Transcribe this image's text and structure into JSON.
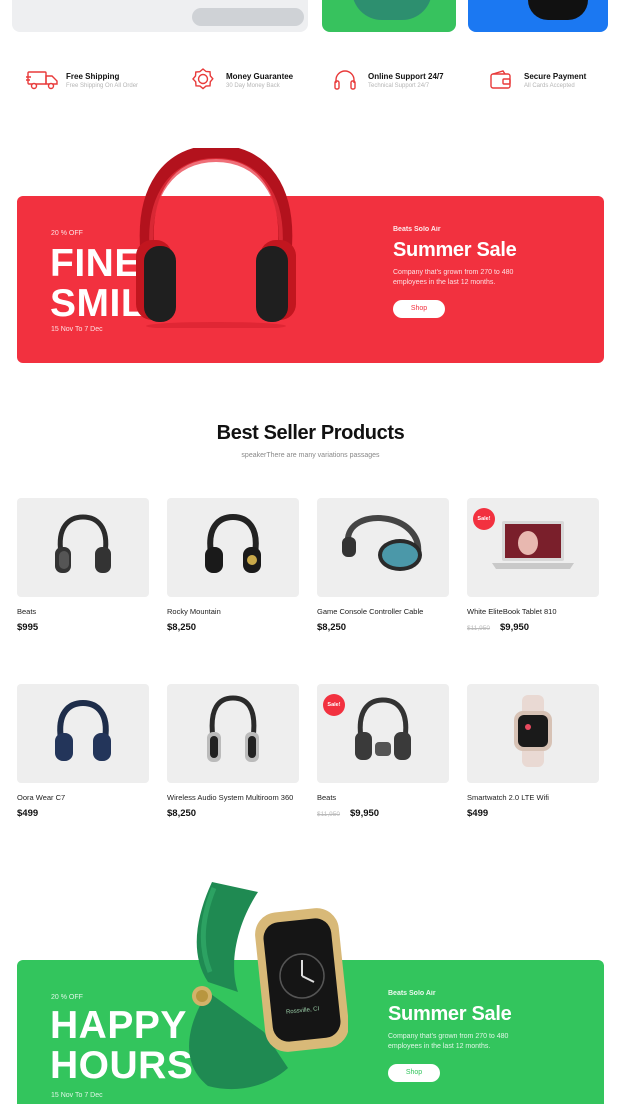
{
  "features": [
    {
      "icon": "truck-icon",
      "title": "Free Shipping",
      "subtitle": "Free Shipping On All Order"
    },
    {
      "icon": "medal-icon",
      "title": "Money Guarantee",
      "subtitle": "30 Day Money Back"
    },
    {
      "icon": "headset-icon",
      "title": "Online Support 24/7",
      "subtitle": "Technical Support 24/7"
    },
    {
      "icon": "wallet-icon",
      "title": "Secure Payment",
      "subtitle": "All Cards Accepted"
    }
  ],
  "banner_top": {
    "discount": "20 % OFF",
    "headline_1": "FINE",
    "headline_2": "SMILE",
    "date": "15 Nov To 7 Dec",
    "subtitle": "Beats Solo Air",
    "title": "Summer Sale",
    "description": "Company that's grown from 270 to 480 employees in the last 12 months.",
    "button": "Shop",
    "color": "#f2313f"
  },
  "section": {
    "title": "Best Seller Products",
    "subtitle": "speakerThere are many variations passages"
  },
  "products": [
    {
      "name": "Beats",
      "price": "$995",
      "old_price": "",
      "sale": false,
      "icon": "headphones-icon"
    },
    {
      "name": "Rocky Mountain",
      "price": "$8,250",
      "old_price": "",
      "sale": false,
      "icon": "headphones-icon"
    },
    {
      "name": "Game Console Controller Cable",
      "price": "$8,250",
      "old_price": "",
      "sale": false,
      "icon": "headphones-icon"
    },
    {
      "name": "White EliteBook Tablet 810",
      "price": "$9,950",
      "old_price": "$11,950",
      "sale": true,
      "icon": "laptop-icon"
    },
    {
      "name": "Oora Wear C7",
      "price": "$499",
      "old_price": "",
      "sale": false,
      "icon": "headphones-icon"
    },
    {
      "name": "Wireless Audio System Multiroom 360",
      "price": "$8,250",
      "old_price": "",
      "sale": false,
      "icon": "headphones-icon"
    },
    {
      "name": "Beats",
      "price": "$9,950",
      "old_price": "$11,950",
      "sale": true,
      "icon": "headphones-icon"
    },
    {
      "name": "Smartwatch 2.0 LTE Wifi",
      "price": "$499",
      "old_price": "",
      "sale": false,
      "icon": "watch-icon"
    }
  ],
  "sale_badge": "Sale!",
  "banner_bottom": {
    "discount": "20 % OFF",
    "headline_1": "HAPPY",
    "headline_2": "HOURS",
    "date": "15 Nov To 7 Dec",
    "subtitle": "Beats Solo Air",
    "title": "Summer Sale",
    "description": "Company that's grown from 270 to 480 employees in the last 12 months.",
    "button": "Shop",
    "color": "#33c55d",
    "watch_text": "Rossville, CI"
  }
}
